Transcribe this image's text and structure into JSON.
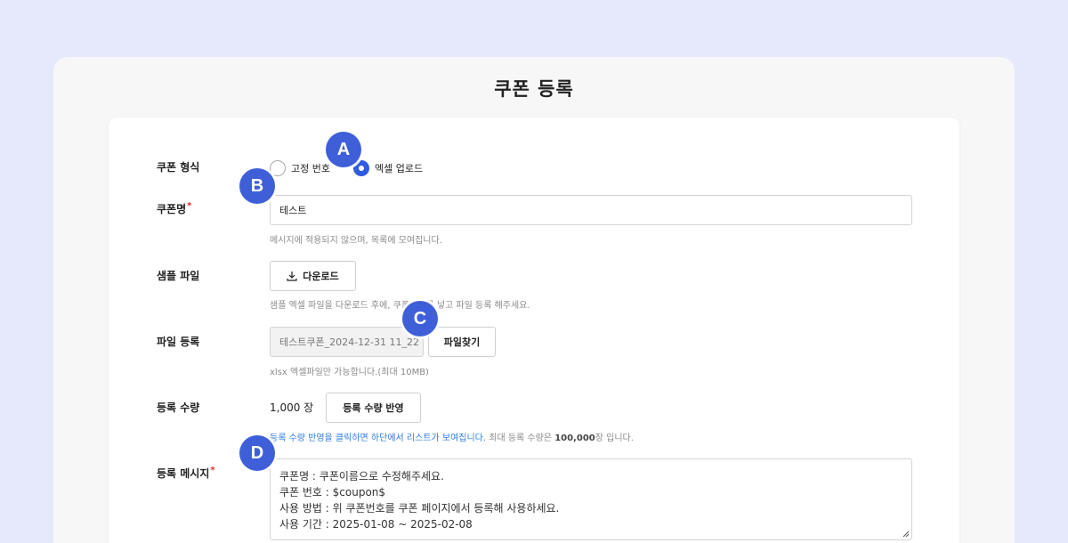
{
  "page": {
    "title": "쿠폰 등록"
  },
  "coupon_type": {
    "label": "쿠폰 형식",
    "options": [
      {
        "label": "고정 번호",
        "checked": false
      },
      {
        "label": "엑셀 업로드",
        "checked": true
      }
    ]
  },
  "coupon_name": {
    "label": "쿠폰명",
    "required_mark": "*",
    "value": "테스트",
    "help": "메시지에 적용되지 않으며, 목록에 모여집니다."
  },
  "sample_file": {
    "label": "샘플 파일",
    "download_label": "다운로드",
    "help": "샘플 엑셀 파일을 다운로드 후에, 쿠폰번호를 넣고 파일 등록 해주세요."
  },
  "file_register": {
    "label": "파일 등록",
    "file_value": "테스트쿠폰_2024-12-31 11_22",
    "find_button": "파일찾기",
    "help": "xlsx 엑셀파일만 가능합니다.(최대 10MB)"
  },
  "register_qty": {
    "label": "등록 수량",
    "value": "1,000 장",
    "apply_button": "등록 수량 반영",
    "help_blue": "등록 수량 반영을 클릭하면 하단에서 리스트가 보여집니다.",
    "help_pre": " 최대 등록 수량은 ",
    "help_bold": "100,000",
    "help_post": "장 입니다."
  },
  "register_message": {
    "label": "등록 메시지",
    "required_mark": "*",
    "lines": [
      "쿠폰명 : 쿠폰이름으로 수정해주세요.",
      "쿠폰 번호 : $coupon$",
      "사용 방법 : 위 쿠폰번호를 쿠폰 페이지에서 등록해 사용하세요.",
      "사용 기간 : 2025-01-08 ~ 2025-02-08"
    ]
  },
  "badges": [
    "A",
    "B",
    "C",
    "D"
  ],
  "colors": {
    "accent": "#3f5fd9",
    "radio": "#2f5be0",
    "link": "#2f7de0",
    "required": "#e02b2b"
  }
}
